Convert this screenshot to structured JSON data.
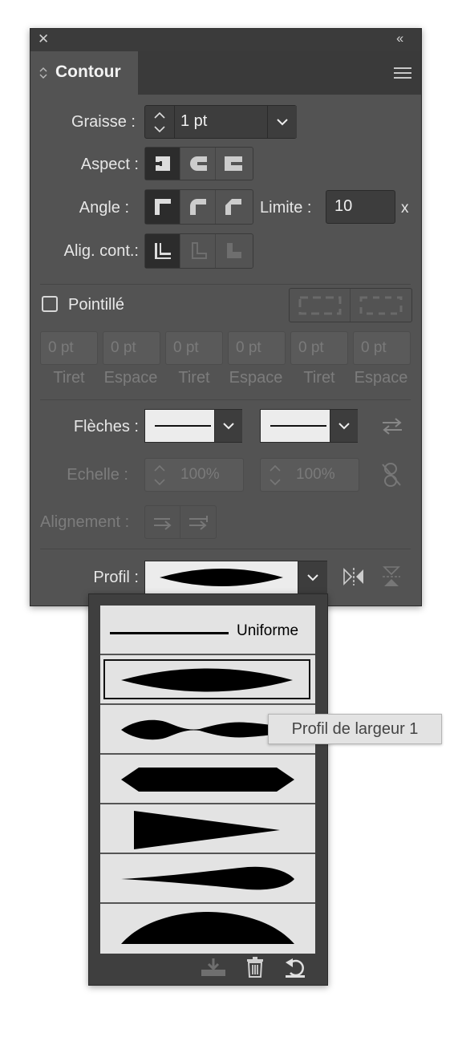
{
  "panel": {
    "title": "Contour",
    "close_glyph": "✕",
    "collapse_glyph": "‹‹"
  },
  "weight": {
    "label": "Graisse :",
    "value": "1 pt"
  },
  "cap": {
    "label": "Aspect :"
  },
  "corner": {
    "label": "Angle :",
    "limit_label": "Limite :",
    "limit_value": "10",
    "limit_unit": "x"
  },
  "align_stroke": {
    "label": "Alig. cont.:"
  },
  "dashed": {
    "label": "Pointillé",
    "checked": false,
    "fields": [
      {
        "value": "0 pt",
        "label": "Tiret"
      },
      {
        "value": "0 pt",
        "label": "Espace"
      },
      {
        "value": "0 pt",
        "label": "Tiret"
      },
      {
        "value": "0 pt",
        "label": "Espace"
      },
      {
        "value": "0 pt",
        "label": "Tiret"
      },
      {
        "value": "0 pt",
        "label": "Espace"
      }
    ]
  },
  "arrowheads": {
    "label": "Flèches :"
  },
  "scale": {
    "label": "Echelle :",
    "start": "100%",
    "end": "100%"
  },
  "alignment": {
    "label": "Alignement :"
  },
  "profile": {
    "label": "Profil :",
    "options": [
      {
        "name": "Uniforme"
      },
      {
        "name": ""
      },
      {
        "name": ""
      },
      {
        "name": ""
      },
      {
        "name": ""
      },
      {
        "name": ""
      },
      {
        "name": ""
      }
    ],
    "selected_index": 1
  },
  "tooltip": {
    "text": "Profil de largeur 1"
  },
  "colors": {
    "panel": "#535353",
    "header": "#3b3b3b",
    "text": "#e6e6e6",
    "disabled": "#7c7c7c"
  }
}
